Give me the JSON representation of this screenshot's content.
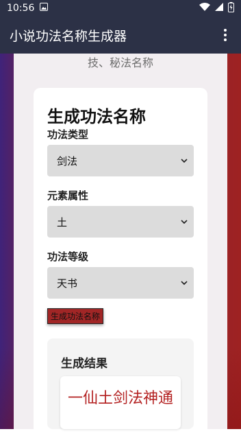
{
  "status_bar": {
    "time": "10:56"
  },
  "app_bar": {
    "title": "小说功法名称生成器"
  },
  "page": {
    "subtitle": "技、秘法名称",
    "heading": "生成功法名称"
  },
  "form": {
    "type_label": "功法类型",
    "type_value": "剑法",
    "element_label": "元素属性",
    "element_value": "土",
    "grade_label": "功法等级",
    "grade_value": "天书",
    "generate_label": "生成功法名称"
  },
  "result": {
    "title": "生成结果",
    "value": "一仙土剑法神通"
  },
  "colors": {
    "app_bar": "#2c3146",
    "accent": "#a12626",
    "result_text": "#b32020"
  },
  "icons": [
    "image-icon",
    "wifi-icon",
    "signal-icon",
    "battery-icon",
    "more-vert-icon",
    "chevron-down-icon"
  ]
}
